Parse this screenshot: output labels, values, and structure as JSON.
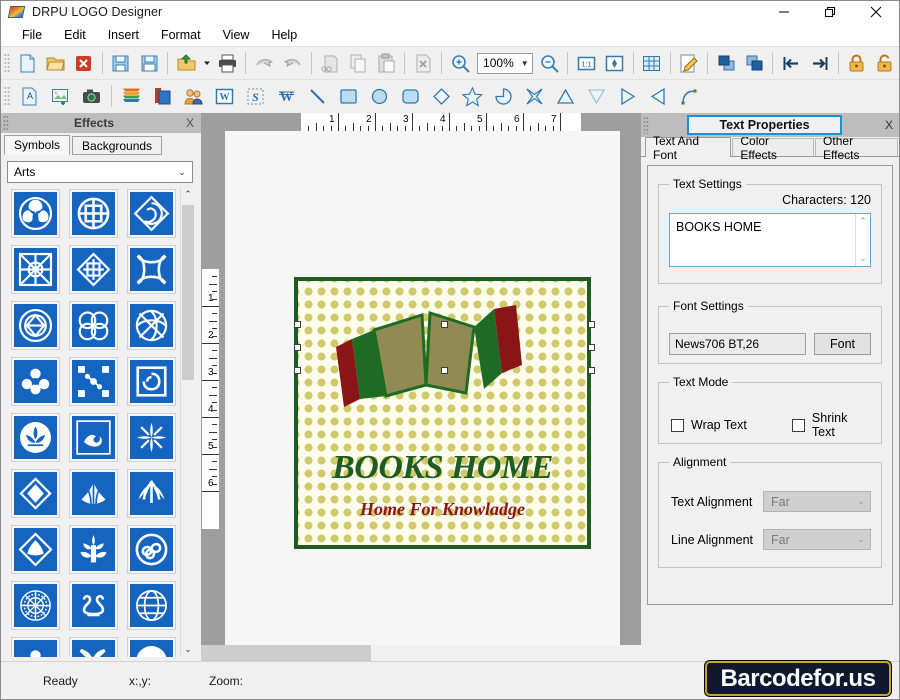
{
  "window": {
    "title": "DRPU LOGO Designer",
    "icon": "app-logo-icon",
    "minimize": "minimize-icon",
    "maximize": "restore-icon",
    "close": "close-icon"
  },
  "menu": {
    "items": [
      "File",
      "Edit",
      "Insert",
      "Format",
      "View",
      "Help"
    ]
  },
  "toolbar_row1": {
    "zoom_value": "100%",
    "icons": [
      "new-document-icon",
      "open-folder-icon",
      "close-document-icon",
      "save-icon",
      "save-as-icon",
      "import-folder-icon",
      "print-icon",
      "undo-icon",
      "redo-icon",
      "cut-icon",
      "copy-icon",
      "paste-icon",
      "delete-icon",
      "zoom-in-icon",
      "zoom-out-icon",
      "actual-size-icon",
      "fit-to-window-icon",
      "grid-icon",
      "edit-properties-icon",
      "bring-to-front-icon",
      "send-to-back-icon",
      "align-left-icon",
      "align-right-icon",
      "lock-icon",
      "unlock-icon"
    ]
  },
  "toolbar_row2": {
    "icons": [
      "insert-text-icon",
      "insert-image-icon",
      "capture-image-icon",
      "insert-barcode-icon",
      "insert-shape-icon",
      "insert-watermark-icon",
      "insert-word-art-icon",
      "insert-signature-icon",
      "insert-symbol-icon",
      "line-tool-icon",
      "rectangle-tool-icon",
      "ellipse-tool-icon",
      "rounded-rect-tool-icon",
      "diamond-tool-icon",
      "star-tool-icon",
      "pie-tool-icon",
      "four-point-star-tool-icon",
      "triangle-tool-icon",
      "inverted-triangle-tool-icon",
      "right-arrow-tool-icon",
      "left-arrow-tool-icon",
      "curve-tool-icon"
    ]
  },
  "effects_panel": {
    "title": "Effects",
    "close": "X",
    "tabs": [
      {
        "label": "Symbols",
        "active": true
      },
      {
        "label": "Backgrounds",
        "active": false
      }
    ],
    "category": "Arts",
    "scroll_up": "scroll-up-icon",
    "scroll_down": "scroll-down-icon",
    "symbols": [
      "triskelion-symbol",
      "celtic-wheel-symbol",
      "spiral-diamond-symbol",
      "celtic-cross-square-symbol",
      "knot-diamond-symbol",
      "interlace-knot-symbol",
      "double-ring-symbol",
      "trefoil-knot-symbol",
      "woven-knot-symbol",
      "floral-cross-symbol",
      "dotted-network-symbol",
      "swirl-square-symbol",
      "lotus-crest-symbol",
      "crescent-leaf-symbol",
      "four-leaf-symbol",
      "diamond-petal-symbol",
      "fan-palm-symbol",
      "leaf-spray-symbol",
      "shell-diamond-symbol",
      "oak-tree-symbol",
      "triple-spiral-symbol",
      "sunburst-medallion-symbol",
      "scroll-ornament-symbol",
      "globe-crest-symbol",
      "heart-clover-symbol",
      "crossed-tools-symbol",
      "bird-circle-symbol"
    ]
  },
  "canvas": {
    "ruler_h_labels": [
      "1",
      "2",
      "3",
      "4",
      "5",
      "6",
      "7"
    ],
    "ruler_v_labels": [
      "1",
      "2",
      "3",
      "4",
      "5",
      "6"
    ],
    "logo": {
      "title": "BOOKS HOME",
      "tagline": "Home For Knowladge",
      "border_color": "#1f5c22",
      "background_color": "#fdfdee",
      "dot_color": "#cfc96a",
      "title_color": "#1f5c22",
      "tagline_color": "#8b1418",
      "book_colors": [
        "#8b1418",
        "#1f6b24",
        "#8f8b52"
      ],
      "selected": true
    }
  },
  "text_properties": {
    "title": "Text Properties",
    "close": "X",
    "accent_color": "#1e90d8",
    "tabs": [
      {
        "label": "Text And Font",
        "active": true
      },
      {
        "label": "Color Effects",
        "active": false
      },
      {
        "label": "Other Effects",
        "active": false
      }
    ],
    "text_settings": {
      "legend": "Text Settings",
      "characters_label": "Characters: 120",
      "value": "BOOKS HOME",
      "scroll_up": "scroll-up-icon",
      "scroll_down": "scroll-down-icon"
    },
    "font_settings": {
      "legend": "Font Settings",
      "value": "News706 BT,26",
      "button": "Font"
    },
    "text_mode": {
      "legend": "Text Mode",
      "wrap_label": "Wrap Text",
      "wrap_checked": false,
      "shrink_label": "Shrink Text",
      "shrink_checked": false
    },
    "alignment": {
      "legend": "Alignment",
      "text_alignment_label": "Text Alignment",
      "text_alignment_value": "Far",
      "line_alignment_label": "Line Alignment",
      "line_alignment_value": "Far"
    }
  },
  "statusbar": {
    "ready": "Ready",
    "coords": "x:,y:",
    "zoom": "Zoom:",
    "brand": "Barcodefor.us"
  }
}
